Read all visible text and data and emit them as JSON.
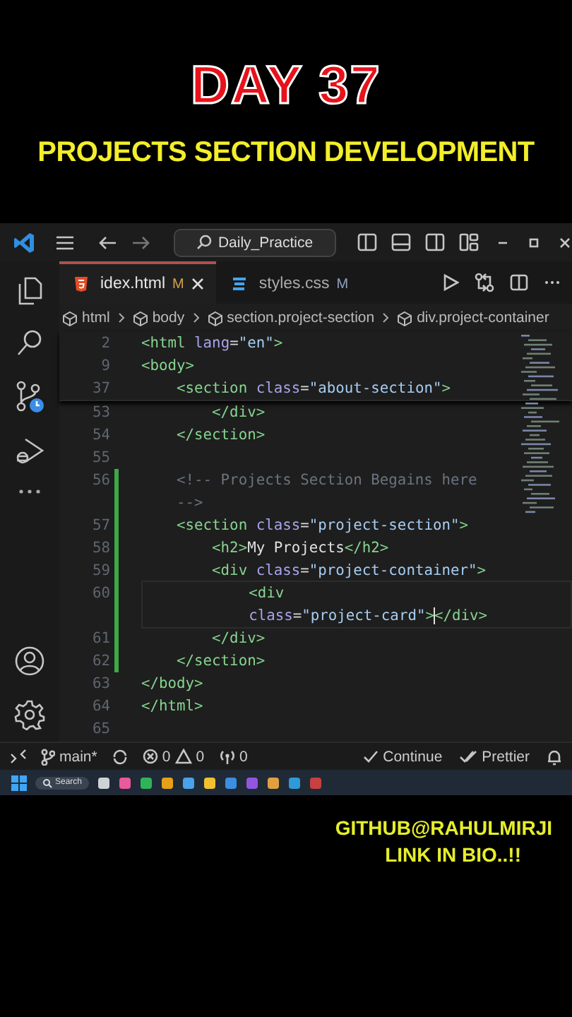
{
  "overlay": {
    "title": "DAY 37",
    "subtitle": "PROJECTS SECTION DEVELOPMENT",
    "footer": [
      "GITHUB@RAHULMIRJI",
      "LINK IN BIO..!!"
    ]
  },
  "window": {
    "command_center": "Daily_Practice"
  },
  "tabs": [
    {
      "label": "idex.html",
      "badge": "M",
      "kind": "html",
      "selected": true
    },
    {
      "label": "styles.css",
      "badge": "M",
      "kind": "css",
      "selected": false
    }
  ],
  "breadcrumb": [
    "html",
    "body",
    "section.project-section",
    "div.project-container"
  ],
  "sticky_lines": [
    {
      "number": "2",
      "rows": [
        [
          {
            "kind": "tag",
            "text": "<html "
          },
          {
            "kind": "attr",
            "text": "lang"
          },
          {
            "kind": "punct",
            "text": "="
          },
          {
            "kind": "str",
            "text": "\"en\""
          },
          {
            "kind": "tag",
            "text": ">"
          }
        ]
      ]
    },
    {
      "number": "9",
      "rows": [
        [
          {
            "kind": "tag",
            "text": "<body>"
          }
        ]
      ]
    },
    {
      "number": "37",
      "rows": [
        [
          {
            "kind": "tag",
            "text": "    <section "
          },
          {
            "kind": "attr",
            "text": "class"
          },
          {
            "kind": "punct",
            "text": "="
          },
          {
            "kind": "str",
            "text": "\"about-section\""
          },
          {
            "kind": "tag",
            "text": ">"
          }
        ]
      ]
    }
  ],
  "lines": [
    {
      "number": "53",
      "changed": false,
      "current": false,
      "rows": [
        [
          {
            "kind": "tag",
            "text": "        </div>"
          }
        ]
      ]
    },
    {
      "number": "54",
      "changed": false,
      "current": false,
      "rows": [
        [
          {
            "kind": "tag",
            "text": "    </section>"
          }
        ]
      ]
    },
    {
      "number": "55",
      "changed": false,
      "current": false,
      "rows": [
        []
      ]
    },
    {
      "number": "56",
      "changed": true,
      "current": false,
      "rows": [
        [
          {
            "kind": "comment",
            "text": "    <!-- Projects Section Begains here"
          }
        ],
        [
          {
            "kind": "comment",
            "text": "    -->"
          }
        ]
      ]
    },
    {
      "number": "57",
      "changed": true,
      "current": false,
      "rows": [
        [
          {
            "kind": "tag",
            "text": "    <section "
          },
          {
            "kind": "attr",
            "text": "class"
          },
          {
            "kind": "punct",
            "text": "="
          },
          {
            "kind": "str",
            "text": "\"project-section\""
          },
          {
            "kind": "tag",
            "text": ">"
          }
        ]
      ]
    },
    {
      "number": "58",
      "changed": true,
      "current": false,
      "rows": [
        [
          {
            "kind": "tag",
            "text": "        <h2>"
          },
          {
            "kind": "text",
            "text": "My Projects"
          },
          {
            "kind": "tag",
            "text": "</h2>"
          }
        ]
      ]
    },
    {
      "number": "59",
      "changed": true,
      "current": false,
      "rows": [
        [
          {
            "kind": "tag",
            "text": "        <div "
          },
          {
            "kind": "attr",
            "text": "class"
          },
          {
            "kind": "punct",
            "text": "="
          },
          {
            "kind": "str",
            "text": "\"project-container\""
          },
          {
            "kind": "tag",
            "text": ">"
          }
        ]
      ]
    },
    {
      "number": "60",
      "changed": true,
      "current": true,
      "rows": [
        [
          {
            "kind": "tag",
            "text": "            <div"
          }
        ],
        [
          {
            "kind": "attr",
            "text": "            class"
          },
          {
            "kind": "punct",
            "text": "="
          },
          {
            "kind": "str",
            "text": "\"project-card\""
          },
          {
            "kind": "tag",
            "text": ">"
          },
          {
            "kind": "cursor"
          },
          {
            "kind": "tag",
            "text": "</div>"
          }
        ]
      ]
    },
    {
      "number": "61",
      "changed": true,
      "current": false,
      "rows": [
        [
          {
            "kind": "tag",
            "text": "        </div>"
          }
        ]
      ]
    },
    {
      "number": "62",
      "changed": true,
      "current": false,
      "rows": [
        [
          {
            "kind": "tag",
            "text": "    </section>"
          }
        ]
      ]
    },
    {
      "number": "63",
      "changed": false,
      "current": false,
      "rows": [
        [
          {
            "kind": "tag",
            "text": "</body>"
          }
        ]
      ]
    },
    {
      "number": "64",
      "changed": false,
      "current": false,
      "rows": [
        [
          {
            "kind": "tag",
            "text": "</html>"
          }
        ]
      ]
    },
    {
      "number": "65",
      "changed": false,
      "current": false,
      "rows": [
        []
      ]
    }
  ],
  "status_bar": {
    "branch": "main*",
    "errors": "0",
    "warnings": "0",
    "ports": "0",
    "actions": [
      "Continue",
      "Prettier"
    ]
  },
  "taskbar": {
    "search": "Search"
  }
}
